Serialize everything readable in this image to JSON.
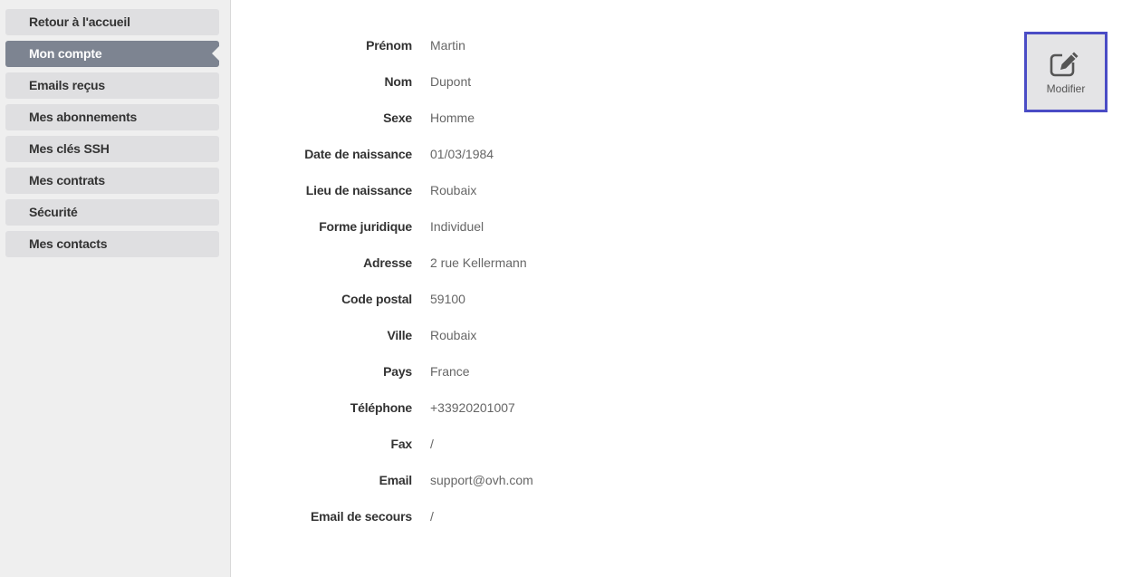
{
  "sidebar": {
    "items": [
      {
        "label": "Retour à l'accueil"
      },
      {
        "label": "Mon compte"
      },
      {
        "label": "Emails reçus"
      },
      {
        "label": "Mes abonnements"
      },
      {
        "label": "Mes clés SSH"
      },
      {
        "label": "Mes contrats"
      },
      {
        "label": "Sécurité"
      },
      {
        "label": "Mes contacts"
      }
    ],
    "active_index": 1
  },
  "profile": {
    "fields": [
      {
        "label": "Prénom",
        "value": "Martin"
      },
      {
        "label": "Nom",
        "value": "Dupont"
      },
      {
        "label": "Sexe",
        "value": "Homme"
      },
      {
        "label": "Date de naissance",
        "value": "01/03/1984"
      },
      {
        "label": "Lieu de naissance",
        "value": "Roubaix"
      },
      {
        "label": "Forme juridique",
        "value": "Individuel"
      },
      {
        "label": "Adresse",
        "value": "2 rue Kellermann"
      },
      {
        "label": "Code postal",
        "value": "59100"
      },
      {
        "label": "Ville",
        "value": "Roubaix"
      },
      {
        "label": "Pays",
        "value": "France"
      },
      {
        "label": "Téléphone",
        "value": "+33920201007"
      },
      {
        "label": "Fax",
        "value": "/"
      },
      {
        "label": "Email",
        "value": "support@ovh.com"
      },
      {
        "label": "Email de secours",
        "value": "/"
      }
    ]
  },
  "actions": {
    "edit_label": "Modifier",
    "edit_icon": "edit-icon"
  },
  "colors": {
    "active_nav_bg": "#7d8491",
    "nav_bg": "#dfdfe1",
    "focus_border": "#4a4cc5"
  }
}
